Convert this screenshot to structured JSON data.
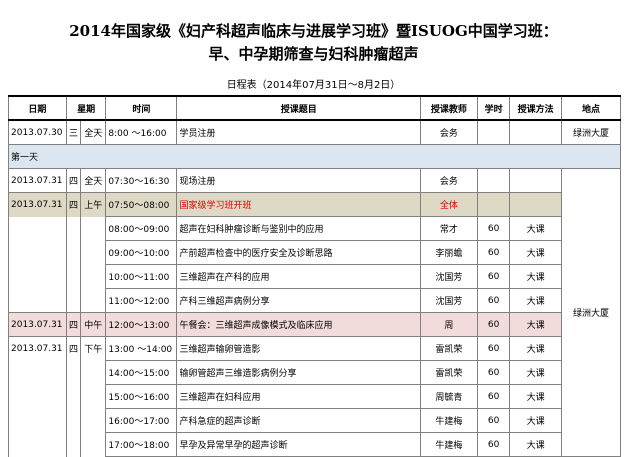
{
  "title_line1": "2014年国家级《妇产科超声临床与进展学习班》暨ISUOG中国学习班：",
  "title_line2": "早、中孕期筛查与妇科肿瘤超声",
  "schedule_caption": "日程表（2014年07月31日～8月2日）",
  "headers": {
    "date": "日期",
    "weekday": "星期",
    "time": "时间",
    "topic": "授课题目",
    "teacher": "授课教师",
    "hours": "学时",
    "method": "授课方法",
    "venue": "地点"
  },
  "registration": {
    "date": "2013.07.30",
    "weekday": "三",
    "period": "全天",
    "time": "8:00 ～16:00",
    "topic": "学员注册",
    "teacher": "会务",
    "venue": "绿洲大厦"
  },
  "day_label": "第一天",
  "day1_venue": "绿洲大厦",
  "rows": [
    {
      "date": "2013.07.31",
      "weekday": "四",
      "period": "全天",
      "time": "07:30～16:30",
      "topic": "现场注册",
      "teacher": "会务",
      "hours": "",
      "method": ""
    },
    {
      "date": "2013.07.31",
      "weekday": "四",
      "period": "上午",
      "time": "07:50～08:00",
      "topic": "国家级学习班开班",
      "teacher": "全体",
      "hours": "",
      "method": ""
    },
    {
      "date": "",
      "weekday": "",
      "period": "",
      "time": "08:00～09:00",
      "topic": "超声在妇科肿瘤诊断与鉴别中的应用",
      "teacher": "常才",
      "hours": "60",
      "method": "大课"
    },
    {
      "date": "",
      "weekday": "",
      "period": "",
      "time": "09:00～10:00",
      "topic": "产前超声检查中的医疗安全及诊断思路",
      "teacher": "李丽蟾",
      "hours": "60",
      "method": "大课"
    },
    {
      "date": "",
      "weekday": "",
      "period": "",
      "time": "10:00～11:00",
      "topic": "三维超声在产科的应用",
      "teacher": "沈国芳",
      "hours": "60",
      "method": "大课"
    },
    {
      "date": "",
      "weekday": "",
      "period": "",
      "time": "11:00～12:00",
      "topic": "产科三维超声病例分享",
      "teacher": "沈国芳",
      "hours": "60",
      "method": "大课"
    },
    {
      "date": "2013.07.31",
      "weekday": "四",
      "period": "中午",
      "time": "12:00～13:00",
      "topic": "午餐会：三维超声成像模式及临床应用",
      "teacher": "周",
      "hours": "60",
      "method": "大课"
    },
    {
      "date": "2013.07.31",
      "weekday": "四",
      "period": "下午",
      "time": "13:00 ～14:00",
      "topic": "三维超声输卵管造影",
      "teacher": "雷凯荣",
      "hours": "60",
      "method": "大课"
    },
    {
      "date": "",
      "weekday": "",
      "period": "",
      "time": "14:00～15:00",
      "topic": "输卵管超声三维造影病例分享",
      "teacher": "雷凯荣",
      "hours": "60",
      "method": "大课"
    },
    {
      "date": "",
      "weekday": "",
      "period": "",
      "time": "15:00～16:00",
      "topic": "三维超声在妇科应用",
      "teacher": "周毓青",
      "hours": "60",
      "method": "大课"
    },
    {
      "date": "",
      "weekday": "",
      "period": "",
      "time": "16:00～17:00",
      "topic": "产科急症的超声诊断",
      "teacher": "牛建梅",
      "hours": "60",
      "method": "大课"
    },
    {
      "date": "",
      "weekday": "",
      "period": "",
      "time": "17:00～18:00",
      "topic": "早孕及异常早孕的超声诊断",
      "teacher": "牛建梅",
      "hours": "60",
      "method": "大课"
    }
  ]
}
